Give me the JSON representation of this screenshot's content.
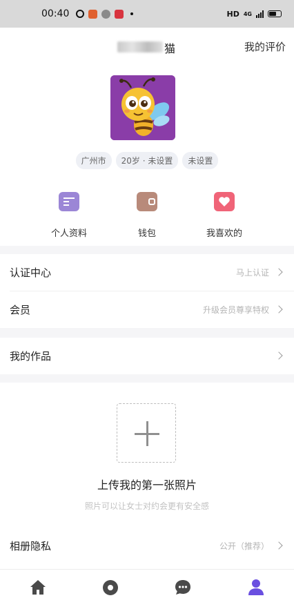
{
  "status_bar": {
    "time": "00:40",
    "network": "HD",
    "signal": "4G"
  },
  "header": {
    "nickname_visible": "猫",
    "review_link": "我的评价"
  },
  "profile": {
    "avatar": "bee-cartoon-avatar",
    "tags": [
      "广州市",
      "20岁 · 未设置",
      "未设置"
    ]
  },
  "quick_actions": [
    {
      "label": "个人资料",
      "icon": "profile-card-icon",
      "color": "#9b86d6"
    },
    {
      "label": "钱包",
      "icon": "wallet-icon",
      "color": "#b88a7a"
    },
    {
      "label": "我喜欢的",
      "icon": "heart-icon",
      "color": "#f06478"
    }
  ],
  "rows": {
    "verify": {
      "title": "认证中心",
      "sub": "马上认证"
    },
    "vip": {
      "title": "会员",
      "sub": "升级会员尊享特权"
    },
    "works": {
      "title": "我的作品",
      "sub": ""
    },
    "privacy": {
      "title": "相册隐私",
      "sub": "公开（推荐）"
    }
  },
  "upload": {
    "title": "上传我的第一张照片",
    "subtitle": "照片可以让女士对约会更有安全感"
  },
  "tabbar": [
    {
      "icon": "home-icon",
      "active": false
    },
    {
      "icon": "discover-icon",
      "active": false
    },
    {
      "icon": "chat-icon",
      "active": false
    },
    {
      "icon": "profile-icon",
      "active": true
    }
  ],
  "colors": {
    "accent": "#6a4fe0",
    "tab_inactive": "#4a4a4a",
    "divider": "#f5f5f7"
  }
}
